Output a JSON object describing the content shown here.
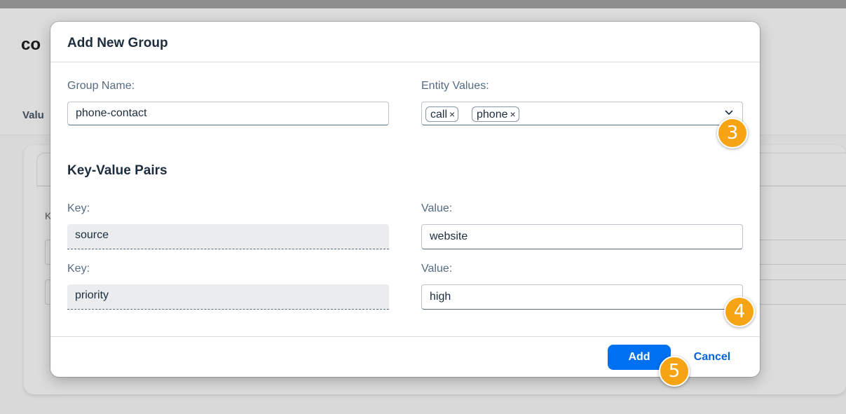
{
  "background": {
    "title": "co",
    "tab_label": "Valu",
    "field_label": "K"
  },
  "dialog": {
    "title": "Add New Group",
    "group_name": {
      "label": "Group Name:",
      "value": "phone-contact"
    },
    "entity_values": {
      "label": "Entity Values:",
      "tokens": [
        "call",
        "phone"
      ],
      "remove_glyph": "×"
    },
    "key_value_section": {
      "title": "Key-Value Pairs",
      "pairs": [
        {
          "key_label": "Key:",
          "key": "source",
          "value_label": "Value:",
          "value": "website"
        },
        {
          "key_label": "Key:",
          "key": "priority",
          "value_label": "Value:",
          "value": "high"
        }
      ]
    },
    "footer": {
      "add_label": "Add",
      "cancel_label": "Cancel"
    }
  },
  "step_badges": [
    "3",
    "4",
    "5"
  ],
  "colors": {
    "accent": "#0070f2",
    "link": "#0064d9",
    "badge": "#f7a414"
  }
}
